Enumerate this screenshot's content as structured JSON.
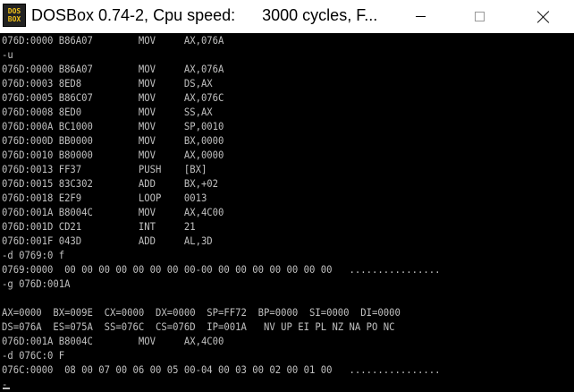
{
  "window": {
    "title": "DOSBox 0.74-2, Cpu speed:      3000 cycles, F...",
    "icon_top": "DOS",
    "icon_bottom": "BOX"
  },
  "console": {
    "lines": [
      "076D:0000 B86A07        MOV     AX,076A",
      "-u",
      "076D:0000 B86A07        MOV     AX,076A",
      "076D:0003 8ED8          MOV     DS,AX",
      "076D:0005 B86C07        MOV     AX,076C",
      "076D:0008 8ED0          MOV     SS,AX",
      "076D:000A BC1000        MOV     SP,0010",
      "076D:000D BB0000        MOV     BX,0000",
      "076D:0010 B80000        MOV     AX,0000",
      "076D:0013 FF37          PUSH    [BX]",
      "076D:0015 83C302        ADD     BX,+02",
      "076D:0018 E2F9          LOOP    0013",
      "076D:001A B8004C        MOV     AX,4C00",
      "076D:001D CD21          INT     21",
      "076D:001F 043D          ADD     AL,3D",
      "-d 0769:0 f",
      "0769:0000  00 00 00 00 00 00 00 00-00 00 00 00 00 00 00 00   ................",
      "-g 076D:001A",
      "",
      "AX=0000  BX=009E  CX=0000  DX=0000  SP=FF72  BP=0000  SI=0000  DI=0000",
      "DS=076A  ES=075A  SS=076C  CS=076D  IP=001A   NV UP EI PL NZ NA PO NC",
      "076D:001A B8004C        MOV     AX,4C00",
      "-d 076C:0 F",
      "076C:0000  08 00 07 00 06 00 05 00-04 00 03 00 02 00 01 00   ................",
      "-"
    ]
  }
}
